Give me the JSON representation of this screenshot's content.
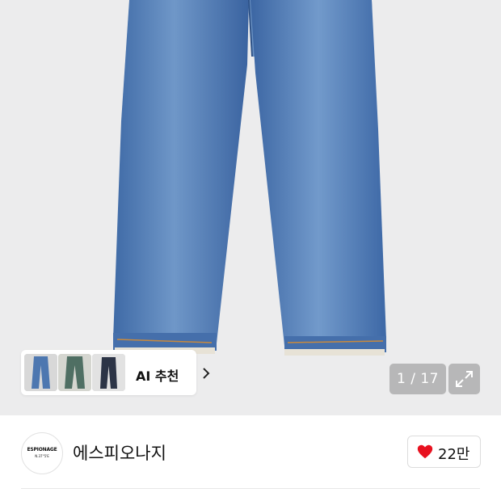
{
  "hero": {
    "image_alt": "denim jeans product photo",
    "counter": "1 / 17"
  },
  "ai_recommend": {
    "label": "AI 추천"
  },
  "store": {
    "logo_line1": "ESPIONAGE",
    "logo_line2": "N.37°5'E",
    "name": "에스피오나지"
  },
  "like": {
    "count": "22만",
    "color": "#e8111f"
  }
}
